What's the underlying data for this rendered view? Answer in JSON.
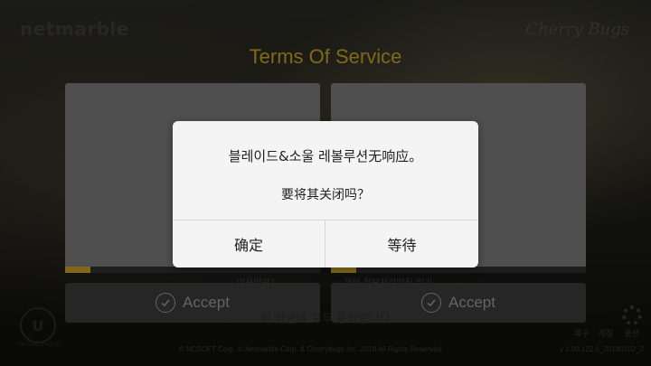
{
  "header": {
    "left_logo": "netmarble",
    "right_logo": "Cherry Bugs",
    "title": "Terms Of Service"
  },
  "panels": [
    {
      "caption": "이용약관1",
      "progress": 0.1,
      "accept_label": "Accept"
    },
    {
      "caption": "개인 정보처리방침 읽기",
      "progress": 0.1,
      "accept_label": "Accept"
    }
  ],
  "agree_all": "위 약관에 모두 동의합니다",
  "footer": {
    "copyright": "© NCSOFT Corp. © Netmarble Corp. & Cherrybugs Inc. 2018 All Rights Reserved.",
    "ue_label": "UNREAL ENGINE",
    "items": [
      "복구",
      "계정",
      "옵션"
    ],
    "version": "v 1.00.122.0_20180102_2"
  },
  "dialog": {
    "message": "블레이드&소울 레볼루션无响应。",
    "question": "要将其关闭吗？",
    "ok_label": "确定",
    "wait_label": "等待"
  },
  "colors": {
    "accent": "#c8a228",
    "dialog_bg": "#f4f4f4"
  }
}
